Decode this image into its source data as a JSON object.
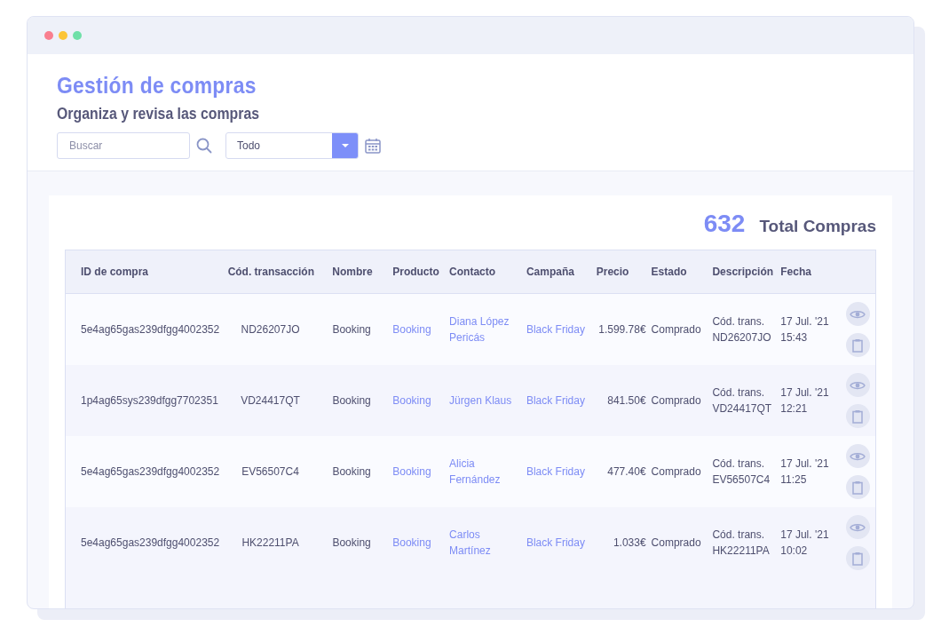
{
  "header": {
    "title": "Gestión de compras",
    "subtitle": "Organiza y revisa las compras"
  },
  "search": {
    "placeholder": "Buscar"
  },
  "filter": {
    "value": "Todo"
  },
  "summary": {
    "count": "632",
    "label": "Total Compras"
  },
  "table": {
    "columns": [
      "ID de compra",
      "Cód. transacción",
      "Nombre",
      "Producto",
      "Contacto",
      "Campaña",
      "Precio",
      "Estado",
      "Descripción",
      "Fecha"
    ],
    "rows": [
      {
        "id": "5e4ag65gas239dfgg4002352",
        "code": "ND26207JO",
        "name": "Booking",
        "product": "Booking",
        "contact": [
          "Diana López",
          "Pericás"
        ],
        "campaign": "Black Friday",
        "price": "1.599.78€",
        "status": "Comprado",
        "description": [
          "Cód. trans.",
          "ND26207JO"
        ],
        "date": "17 Jul. '21",
        "time": "15:43"
      },
      {
        "id": "1p4ag65sys239dfgg7702351",
        "code": "VD24417QT",
        "name": "Booking",
        "product": "Booking",
        "contact": [
          "Jürgen Klaus"
        ],
        "campaign": "Black Friday",
        "price": "841.50€",
        "status": "Comprado",
        "description": [
          "Cód. trans.",
          "VD24417QT"
        ],
        "date": "17 Jul. '21",
        "time": "12:21"
      },
      {
        "id": "5e4ag65gas239dfgg4002352",
        "code": "EV56507C4",
        "name": "Booking",
        "product": "Booking",
        "contact": [
          "Alicia",
          "Fernández"
        ],
        "campaign": "Black Friday",
        "price": "477.40€",
        "status": "Comprado",
        "description": [
          "Cód. trans.",
          "EV56507C4"
        ],
        "date": "17 Jul. '21",
        "time": "11:25"
      },
      {
        "id": "5e4ag65gas239dfgg4002352",
        "code": "HK22211PA",
        "name": "Booking",
        "product": "Booking",
        "contact": [
          "Carlos",
          "Martínez"
        ],
        "campaign": "Black Friday",
        "price": "1.033€",
        "status": "Comprado",
        "description": [
          "Cód. trans.",
          "HK22211PA"
        ],
        "date": "17 Jul. '21",
        "time": "10:02"
      }
    ]
  }
}
